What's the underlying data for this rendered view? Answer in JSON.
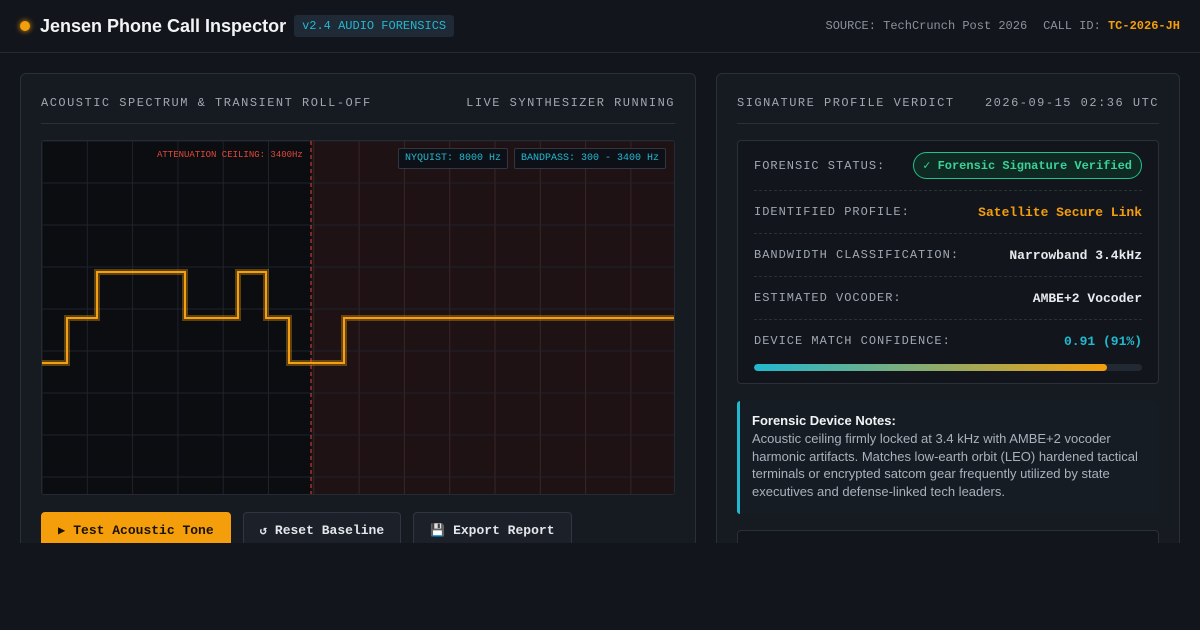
{
  "header": {
    "title": "Jensen Phone Call Inspector",
    "version_badge": "v2.4 AUDIO FORENSICS",
    "source_text": "SOURCE: TechCrunch Post 2026",
    "call_id_label": "CALL ID:",
    "call_id_value": "TC-2026-JH",
    "status_dot_color": "#f59e0b"
  },
  "spectrum_panel": {
    "title": "ACOUSTIC SPECTRUM & TRANSIENT ROLL-OFF",
    "status": "LIVE SYNTHESIZER RUNNING",
    "ceiling_label": "ATTENUATION CEILING: 3400Hz",
    "nyquist_badge": "NYQUIST: 8000 Hz",
    "bandpass_badge": "BANDPASS: 300 - 3400 Hz",
    "waveform_color": "#f5a00f",
    "ceiling_color": "#e0473a"
  },
  "actions": {
    "test_tone": {
      "icon": "play-icon",
      "label": "Test Acoustic Tone"
    },
    "reset": {
      "icon": "reset-icon",
      "label": "Reset Baseline"
    },
    "export": {
      "icon": "floppy-disk-icon",
      "label": "Export Report"
    }
  },
  "verdict_panel": {
    "title": "SIGNATURE PROFILE VERDICT",
    "timestamp": "2026-09-15 02:36 UTC",
    "rows": [
      {
        "label": "FORENSIC STATUS:",
        "value": "✓ Forensic Signature Verified"
      },
      {
        "label": "IDENTIFIED PROFILE:",
        "value": "Satellite Secure Link"
      },
      {
        "label": "BANDWIDTH CLASSIFICATION:",
        "value": "Narrowband 3.4kHz"
      },
      {
        "label": "ESTIMATED VOCODER:",
        "value": "AMBE+2 Vocoder"
      },
      {
        "label": "DEVICE MATCH CONFIDENCE:",
        "value": "0.91 (91%)"
      }
    ],
    "confidence_fraction": 0.91,
    "notes_title": "Forensic Device Notes:",
    "notes_body": "Acoustic ceiling firmly locked at 3.4 kHz with AMBE+2 vocoder harmonic artifacts. Matches low-earth orbit (LEO) hardened tactical terminals or encrypted satcom gear frequently utilized by state executives and defense-linked tech leaders."
  }
}
